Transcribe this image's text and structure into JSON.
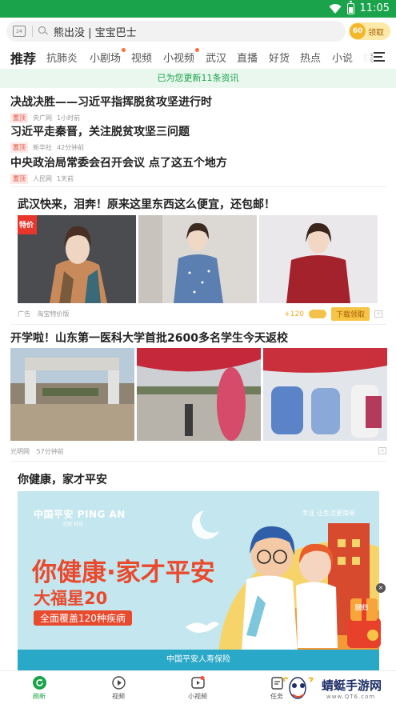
{
  "status_bar": {
    "time": "11:05",
    "color": "#1aa34a"
  },
  "search": {
    "placeholder": "熊出没 | 宝宝巴士",
    "coin_count": "60",
    "coin_label": "领取"
  },
  "tabs": [
    {
      "label": "推荐",
      "active": true
    },
    {
      "label": "抗肺炎"
    },
    {
      "label": "小剧场",
      "dot": true
    },
    {
      "label": "视频"
    },
    {
      "label": "小视频",
      "dot": true
    },
    {
      "label": "武汉"
    },
    {
      "label": "直播"
    },
    {
      "label": "好货"
    },
    {
      "label": "热点"
    },
    {
      "label": "小说"
    },
    {
      "label": "娱"
    }
  ],
  "update_banner": "已为您更新11条资讯",
  "news": [
    {
      "title": "决战决胜——习近平指挥脱贫攻坚进行时",
      "tag": "置顶",
      "source": "央广网",
      "time": "1小时前"
    },
    {
      "title": "习近平走秦晋，关注脱贫攻坚三问题",
      "tag": "置顶",
      "source": "新华社",
      "time": "42分钟前"
    },
    {
      "title": "中央政治局常委会召开会议 点了这五个地方",
      "tag": "置顶",
      "source": "人民网",
      "time": "1天前"
    }
  ],
  "ad": {
    "title": "武汉快来，泪奔！原来这里东西这么便宜，还包邮！",
    "img1_badge": "特价",
    "label": "广告",
    "source": "淘宝特价版",
    "reward": "+120",
    "button": "下载领取"
  },
  "news_photo": {
    "title": "开学啦！山东第一医科大学首批2600多名学生今天返校",
    "source": "光明网",
    "time": "57分钟前"
  },
  "banner": {
    "section_title": "你健康，家才平安",
    "brand": "中国平安 PING AN",
    "brand_sub": "金融·科技",
    "slogan": "专业 让生活更简单",
    "headline": "你健康·家才平安",
    "product": "大福星20",
    "coverage": "全面覆盖120种疾病",
    "footer": "中国平安人寿保险",
    "float_badge": "回归",
    "colors": {
      "accent": "#e84a2e",
      "bg": "#bfe4ec"
    }
  },
  "bottom_nav": [
    {
      "label": "刷新",
      "icon": "refresh-icon",
      "active": true
    },
    {
      "label": "视频",
      "icon": "play-icon"
    },
    {
      "label": "小视频",
      "icon": "small-video-icon"
    },
    {
      "label": "任务",
      "icon": "task-icon"
    }
  ],
  "watermark": {
    "text": "蜻蜓手游网",
    "url": "www.QT6.com"
  }
}
